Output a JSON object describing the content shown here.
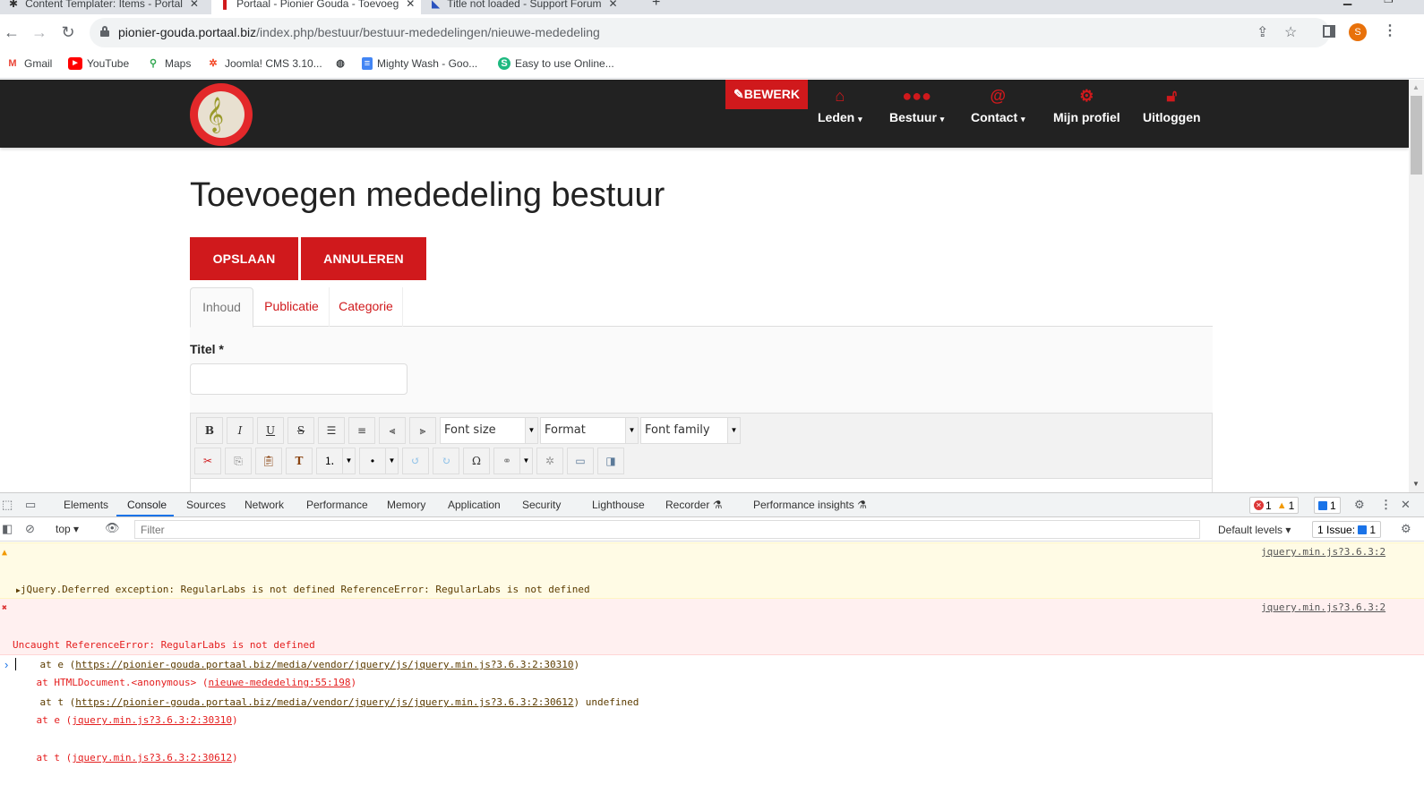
{
  "browser": {
    "tabs": [
      {
        "title": "Content Templater: Items - Portal",
        "active": false
      },
      {
        "title": "Portaal - Pionier Gouda - Toevoeg",
        "active": true
      },
      {
        "title": "Title not loaded - Support Forum",
        "active": false
      }
    ],
    "new_tab": "+",
    "url_host": "pionier-gouda.portaal.biz",
    "url_path": "/index.php/bestuur/bestuur-mededelingen/nieuwe-mededeling",
    "profile_initial": "S",
    "profile_color": "#e8710a",
    "bookmarks": [
      {
        "label": "Gmail",
        "icon": "gmail-icon"
      },
      {
        "label": "YouTube",
        "icon": "youtube-icon"
      },
      {
        "label": "Maps",
        "icon": "maps-icon"
      },
      {
        "label": "Joomla! CMS 3.10...",
        "icon": "joomla-icon"
      },
      {
        "label": "",
        "icon": "globe-icon"
      },
      {
        "label": "Mighty Wash - Goo...",
        "icon": "google-docs-icon"
      },
      {
        "label": "Easy to use Online...",
        "icon": "s-icon"
      }
    ]
  },
  "site": {
    "brand_color": "#d0191c",
    "logo_alt": "Gouda's Harmonie De Pionier",
    "edit_button": "BEWERK",
    "nav": [
      {
        "label": "Leden",
        "icon": "home-icon",
        "dropdown": true
      },
      {
        "label": "Bestuur",
        "icon": "users-icon",
        "dropdown": true
      },
      {
        "label": "Contact",
        "icon": "at-icon",
        "dropdown": true
      },
      {
        "label": "Mijn profiel",
        "icon": "gear-icon",
        "dropdown": false
      },
      {
        "label": "Uitloggen",
        "icon": "unlock-icon",
        "dropdown": false
      }
    ],
    "page_title": "Toevoegen mededeling bestuur",
    "save_button": "OPSLAAN",
    "cancel_button": "ANNULEREN",
    "tabs": [
      {
        "label": "Inhoud",
        "active": true
      },
      {
        "label": "Publicatie",
        "active": false
      },
      {
        "label": "Categorie",
        "active": false
      }
    ],
    "title_label": "Titel *",
    "title_value": "",
    "editor": {
      "row1_buttons": [
        "bold",
        "italic",
        "underline",
        "strikethrough",
        "justify-full",
        "align-center",
        "align-left",
        "align-right"
      ],
      "font_size": "Font size",
      "format": "Format",
      "font_family": "Font family",
      "row2_buttons": [
        "cut",
        "copy",
        "paste",
        "paste-text",
        "numbered-list",
        "bullet-list",
        "undo",
        "redo",
        "special-char",
        "link",
        "unlink",
        "horizontal-rule",
        "template"
      ]
    }
  },
  "devtools": {
    "tabs": [
      "Elements",
      "Console",
      "Sources",
      "Network",
      "Performance",
      "Memory",
      "Application",
      "Security",
      "Lighthouse",
      "Recorder",
      "Performance insights"
    ],
    "active_tab": "Console",
    "error_count": "1",
    "warning_count": "1",
    "message_count": "1",
    "context": "top",
    "filter_placeholder": "Filter",
    "default_levels": "Default levels",
    "issues": "1 Issue:",
    "issues_count": "1",
    "messages": [
      {
        "level": "warning",
        "source": "jquery.min.js?3.6.3:2",
        "lines": [
          {
            "text": "jQuery.Deferred exception: RegularLabs is not defined ReferenceError: RegularLabs is not defined",
            "link": "",
            "suffix": ""
          },
          {
            "text": "    at HTMLDocument.<anonymous> (",
            "link": "https://pionier-gouda.portaal.biz/index.php/bestuur/bestuur-mededelingen/nieuwe-mededeling:55:198",
            "suffix": ")"
          },
          {
            "text": "    at e (",
            "link": "https://pionier-gouda.portaal.biz/media/vendor/jquery/js/jquery.min.js?3.6.3:2:30310",
            "suffix": ")"
          },
          {
            "text": "    at t (",
            "link": "https://pionier-gouda.portaal.biz/media/vendor/jquery/js/jquery.min.js?3.6.3:2:30612",
            "suffix": ") undefined"
          }
        ]
      },
      {
        "level": "error",
        "source": "jquery.min.js?3.6.3:2",
        "lines": [
          {
            "text": "Uncaught ReferenceError: RegularLabs is not defined",
            "link": "",
            "suffix": ""
          },
          {
            "text": "    at HTMLDocument.<anonymous> (",
            "link": "nieuwe-mededeling:55:198",
            "suffix": ")"
          },
          {
            "text": "    at e (",
            "link": "jquery.min.js?3.6.3:2:30310",
            "suffix": ")"
          },
          {
            "text": "    at t (",
            "link": "jquery.min.js?3.6.3:2:30612",
            "suffix": ")"
          }
        ]
      }
    ]
  }
}
